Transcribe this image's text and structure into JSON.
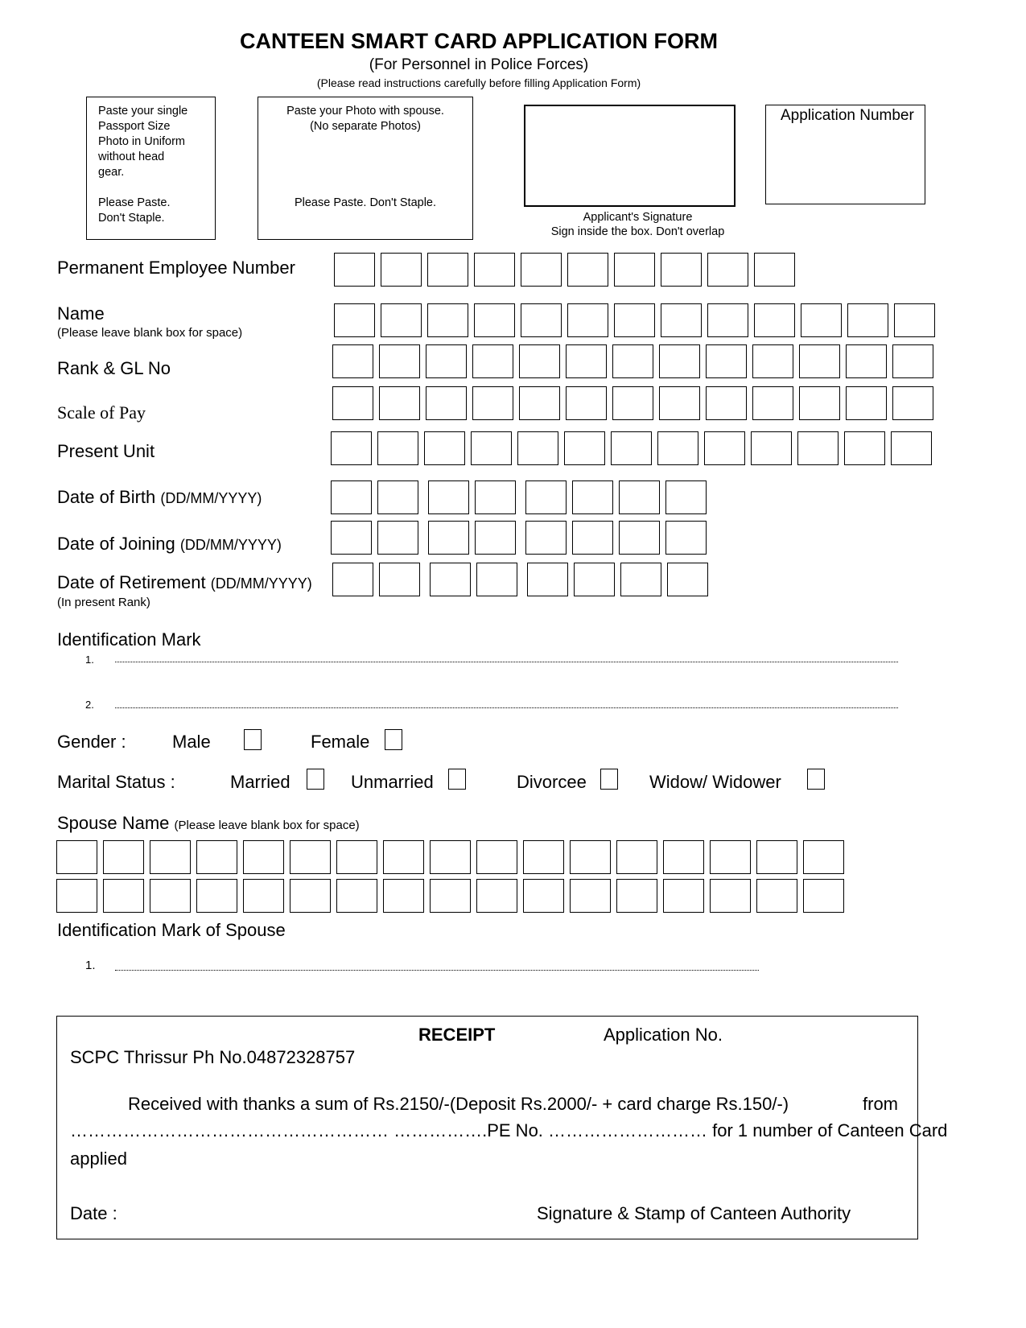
{
  "header": {
    "title": "CANTEEN SMART CARD APPLICATION FORM",
    "subtitle": "(For Personnel in Police Forces)",
    "instruction": "(Please read instructions carefully before filling Application Form)"
  },
  "photo_box": {
    "lines": [
      "Paste your single",
      "Passport Size",
      "Photo in Uniform",
      "without head",
      "gear."
    ],
    "paste_lines": [
      "Please Paste.",
      "Don't Staple."
    ]
  },
  "spouse_photo_box": {
    "line1": "Paste your Photo with spouse.",
    "line2": "(No separate Photos)",
    "paste": "Please Paste. Don't Staple."
  },
  "signature_box": {
    "caption1": "Applicant's Signature",
    "caption2": "Sign inside the box. Don't overlap"
  },
  "application_number_box": {
    "label": "Application Number"
  },
  "fields": {
    "pen": "Permanent Employee Number",
    "name": "Name",
    "name_note": "(Please leave blank box for space)",
    "rank": "Rank & GL No",
    "scale": "Scale of Pay",
    "unit": "Present Unit",
    "dob": "Date of Birth",
    "doj": "Date of Joining",
    "dor": "Date of Retirement",
    "date_format": "(DD/MM/YYYY)",
    "dor_note": "(In present Rank)",
    "id_mark": "Identification Mark",
    "id_1": "1.",
    "id_2": "2."
  },
  "gender": {
    "label": "Gender :",
    "male": "Male",
    "female": "Female"
  },
  "marital": {
    "label": "Marital Status :",
    "married": "Married",
    "unmarried": "Unmarried",
    "divorcee": "Divorcee",
    "widow": "Widow/ Widower"
  },
  "spouse": {
    "name_label": "Spouse Name",
    "name_note": "(Please leave blank box for space)",
    "id_mark": "Identification Mark of Spouse",
    "id_1": "1."
  },
  "receipt": {
    "title": "RECEIPT",
    "app_no": "Application No.",
    "office": "SCPC Thrissur Ph No.04872328757",
    "line1": "Received with thanks a sum of Rs.2150/-(Deposit Rs.2000/- + card charge Rs.150/-)",
    "from": "from",
    "line2a": "……………………………………………… …………….PE No. ……………………… for 1 number of Canteen Card",
    "line3": "applied",
    "date": "Date :",
    "signature": "Signature & Stamp of Canteen Authority"
  }
}
